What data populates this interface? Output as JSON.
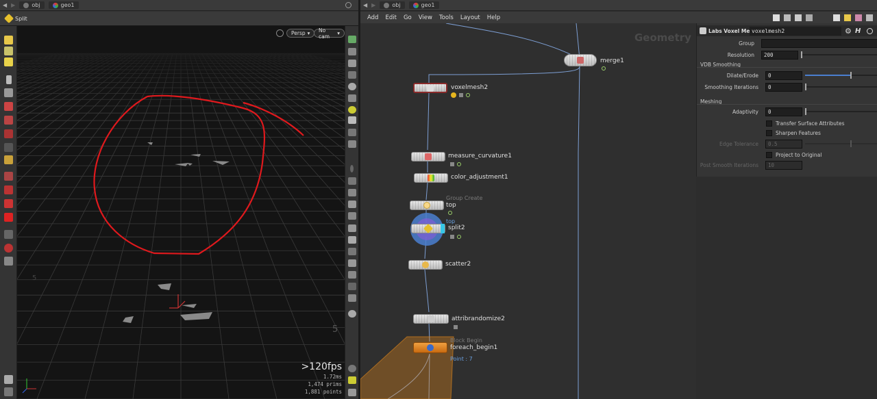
{
  "left_pane": {
    "path": [
      "obj",
      "geo1"
    ],
    "viewport_title": "Split",
    "persp_label": "Persp",
    "cam_label": "No cam",
    "fps": ">120fps",
    "frame_time": "1.72ms",
    "prims_count": "1,474",
    "prims_label": "prims",
    "points_count": "1,881",
    "points_label": "points",
    "grid_labels": [
      "5",
      "5"
    ]
  },
  "right_pane": {
    "path": [
      "obj",
      "geo1"
    ],
    "menu": [
      "Add",
      "Edit",
      "Go",
      "View",
      "Tools",
      "Layout",
      "Help"
    ],
    "context_label": "Geometry",
    "nodes": {
      "merge1": "merge1",
      "voxelmesh2": "voxelmesh2",
      "measure_curvature1": "measure_curvature1",
      "color_adjustment1": "color_adjustment1",
      "top_sub": "Group Create",
      "top": "top",
      "split2_sub": "top",
      "split2": "split2",
      "scatter2": "scatter2",
      "attribrandomize2": "attribrandomize2",
      "foreach_sub": "Block Begin",
      "foreach_begin1": "foreach_begin1",
      "foreach_info": "Point : 7"
    }
  },
  "params": {
    "node_type": "Labs Voxel Mesh",
    "node_name": "voxelmesh2",
    "group_label": "Group",
    "group_value": "",
    "resolution_label": "Resolution",
    "resolution_value": "200",
    "vdb_section": "VDB Smoothing",
    "dilate_label": "Dilate/Erode",
    "dilate_value": "0",
    "smooth_iter_label": "Smoothing Iterations",
    "smooth_iter_value": "0",
    "meshing_section": "Meshing",
    "adaptivity_label": "Adaptivity",
    "adaptivity_value": "0",
    "transfer_label": "Transfer Surface Attributes",
    "sharpen_label": "Sharpen Features",
    "edge_tol_label": "Edge Tolerance",
    "edge_tol_value": "0.5",
    "project_label": "Project to Original",
    "post_smooth_label": "Post Smooth Iterations",
    "post_smooth_value": "10"
  },
  "colors": {
    "annotation_red": "#e0191d",
    "selected_node_ring": "#4a7fd0",
    "foreach_orange": "#e88a1a",
    "wire": "#7d9fd4"
  }
}
